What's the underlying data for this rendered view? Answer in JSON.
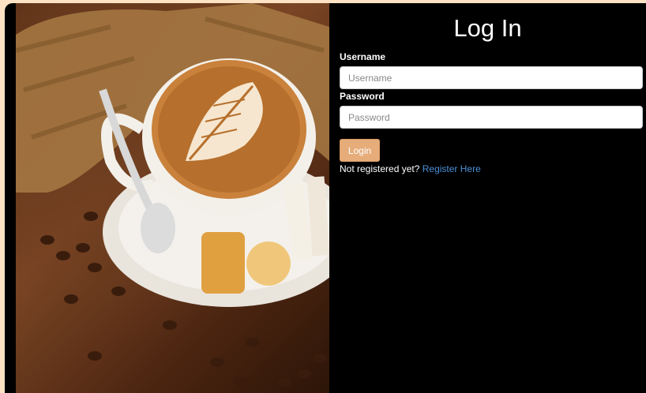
{
  "login": {
    "title": "Log In",
    "username_label": "Username",
    "username_placeholder": "Username",
    "password_label": "Password",
    "password_placeholder": "Password",
    "login_button": "Login",
    "register_prompt": "Not registered yet?",
    "register_link": "Register Here"
  },
  "colors": {
    "background": "#fde3c4",
    "panel": "#000000",
    "button": "#e6ac79",
    "link": "#4a90d9"
  },
  "image": {
    "subject": "latte-art-coffee-cup-with-beans"
  }
}
